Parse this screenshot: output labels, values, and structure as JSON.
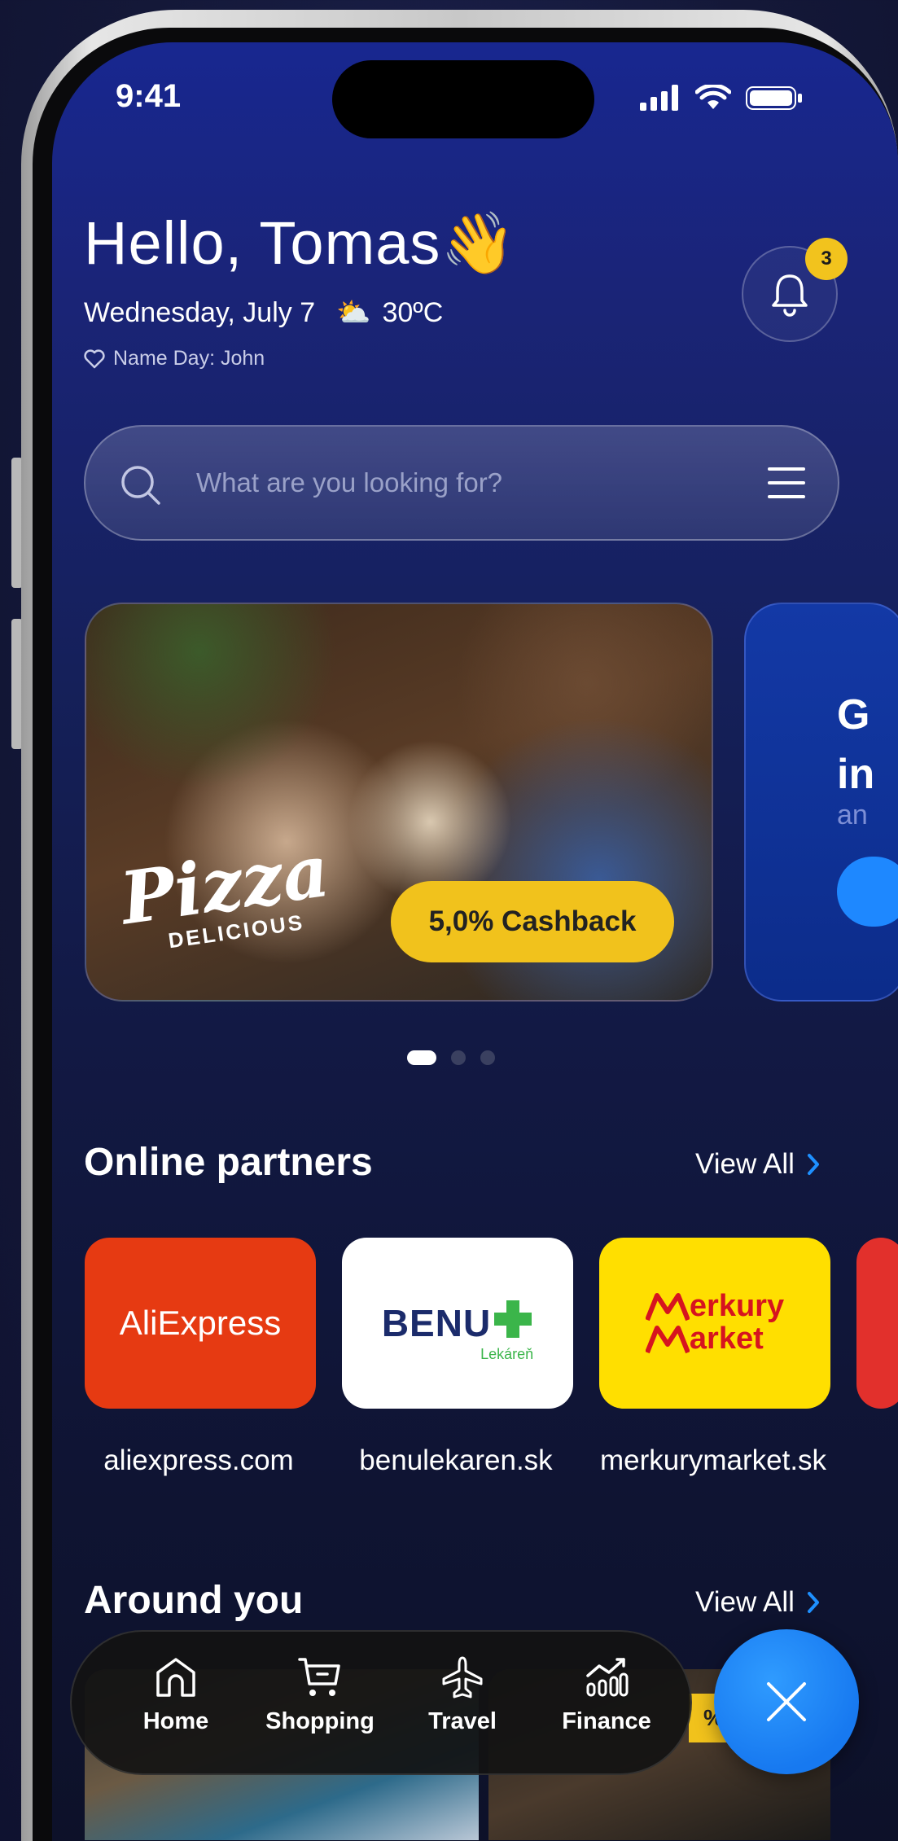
{
  "status_bar": {
    "time": "9:41"
  },
  "header": {
    "greeting": "Hello, Tomas",
    "wave_emoji": "👋",
    "date": "Wednesday, July 7",
    "weather_emoji": "⛅",
    "temperature": "30ºC",
    "name_day": "Name Day: John",
    "notification_count": "3"
  },
  "search": {
    "placeholder": "What are you looking for?"
  },
  "banners": [
    {
      "brand_line1": "Pizza",
      "brand_line2": "DELICIOUS",
      "cashback": "5,0% Cashback"
    },
    {
      "title_partial_1": "G",
      "title_partial_2": "in",
      "subtitle_partial": "an"
    }
  ],
  "carousel": {
    "total": 3,
    "active": 1
  },
  "online_partners": {
    "title": "Online partners",
    "view_all": "View All",
    "items": [
      {
        "logo_text": "AliExpress",
        "label": "aliexpress.com",
        "color": "#e63a12"
      },
      {
        "logo_text": "BENU",
        "logo_sub": "Lekáreň",
        "label": "benulekaren.sk",
        "color": "#ffffff"
      },
      {
        "logo_line1": "erkury",
        "logo_line2": "arket",
        "label": "merkurymarket.sk",
        "color": "#ffdf00"
      }
    ]
  },
  "around_you": {
    "title": "Around you",
    "view_all": "View All",
    "badge_partial": "% C"
  },
  "bottom_nav": {
    "items": [
      {
        "label": "Home",
        "icon": "home-icon"
      },
      {
        "label": "Shopping",
        "icon": "cart-icon"
      },
      {
        "label": "Travel",
        "icon": "plane-icon"
      },
      {
        "label": "Finance",
        "icon": "chart-icon"
      }
    ]
  },
  "colors": {
    "accent_blue": "#1779f0",
    "accent_yellow": "#f1c21c"
  }
}
